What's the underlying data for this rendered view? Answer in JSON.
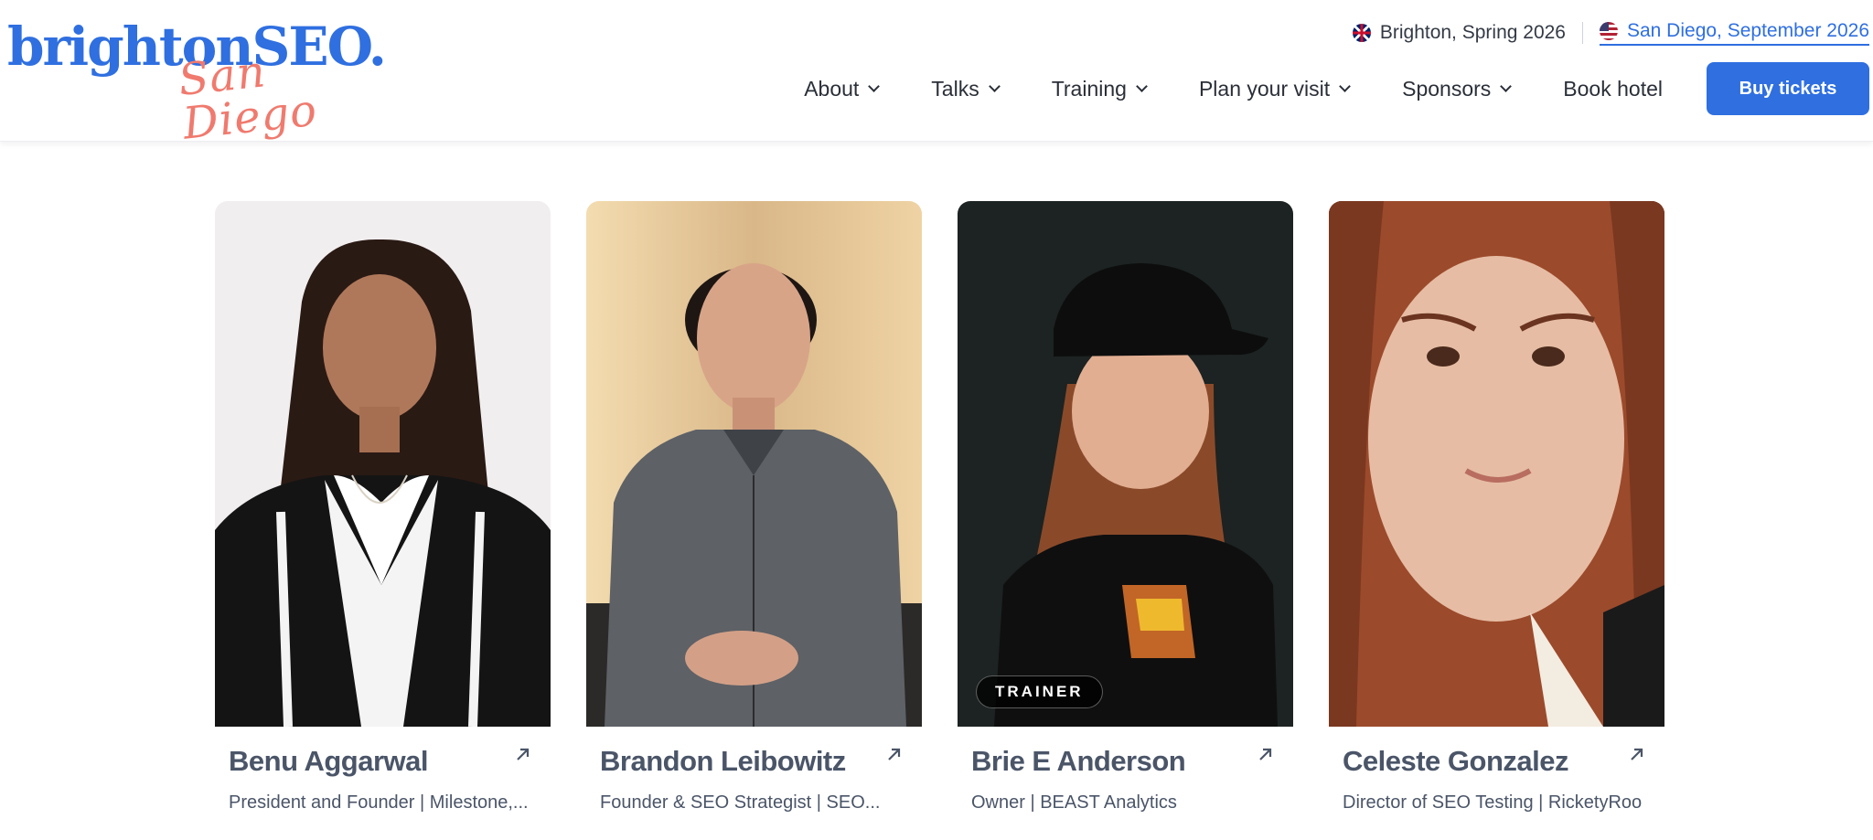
{
  "brand": {
    "name": "brightonSEO.",
    "edition": "San Diego"
  },
  "editions": [
    {
      "label": "Brighton, Spring 2026",
      "flag": "uk-flag-icon",
      "active": false
    },
    {
      "label": "San Diego, September 2026",
      "flag": "us-flag-icon",
      "active": true
    }
  ],
  "nav": {
    "items": [
      {
        "label": "About",
        "dropdown": true
      },
      {
        "label": "Talks",
        "dropdown": true
      },
      {
        "label": "Training",
        "dropdown": true
      },
      {
        "label": "Plan your visit",
        "dropdown": true
      },
      {
        "label": "Sponsors",
        "dropdown": true
      },
      {
        "label": "Book hotel",
        "dropdown": false
      }
    ],
    "cta_label": "Buy tickets"
  },
  "speakers": [
    {
      "name": "Benu Aggarwal",
      "role": "President and Founder | Milestone,...",
      "badge": ""
    },
    {
      "name": "Brandon Leibowitz",
      "role": "Founder & SEO Strategist | SEO...",
      "badge": ""
    },
    {
      "name": "Brie E Anderson",
      "role": "Owner | BEAST Analytics",
      "badge": "TRAINER"
    },
    {
      "name": "Celeste Gonzalez",
      "role": "Director of SEO Testing | RicketyRoo",
      "badge": ""
    }
  ],
  "colors": {
    "brand_blue": "#2f6fe0",
    "brand_coral": "#f07a6e",
    "text_slate": "#4a5568"
  }
}
